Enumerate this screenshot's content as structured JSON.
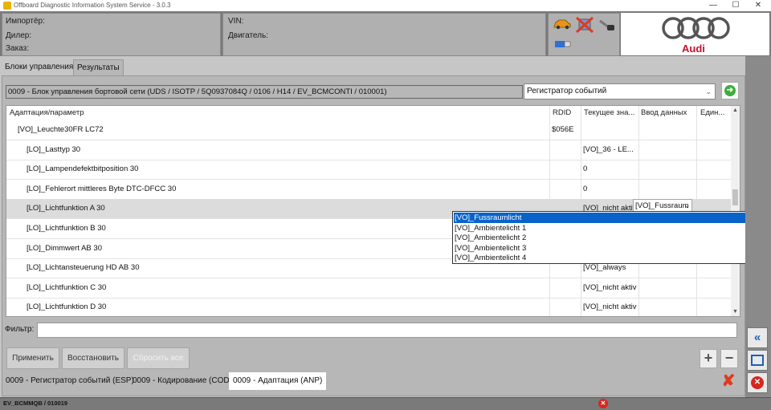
{
  "window": {
    "title": "Offboard Diagnostic Information System Service - 3.0.3",
    "minimize": "—",
    "maximize": "☐",
    "close": "✕"
  },
  "header": {
    "importer_label": "Импортёр:",
    "dealer_label": "Дилер:",
    "order_label": "Заказ:",
    "vin_label": "VIN:",
    "engine_label": "Двигатель:",
    "brand": "Audi"
  },
  "tabs": [
    {
      "label": "Блоки управления",
      "active": false
    },
    {
      "label": "Результаты",
      "active": true
    }
  ],
  "ecu": {
    "description": "0009 - Блок управления бортовой сети  (UDS / ISOTP / 5Q0937084Q  / 0106 / H14 / EV_BCMCONTI / 010001)",
    "mode_selected": "Регистратор событий"
  },
  "grid": {
    "columns": [
      "Адаптация/параметр",
      "RDID",
      "Текущее зна...",
      "Ввод данных",
      "Един..."
    ],
    "rows": [
      {
        "param": "[VO]_Leuchte30FR LC72",
        "rdid": "$056E",
        "current": "",
        "input": "",
        "unit": "",
        "indent": 1,
        "selected": false
      },
      {
        "param": "[LO]_Lasttyp 30",
        "rdid": "",
        "current": "[VO]_36 - LE...",
        "input": "",
        "unit": "",
        "indent": 2,
        "selected": false
      },
      {
        "param": "[LO]_Lampendefektbitposition 30",
        "rdid": "",
        "current": "0",
        "input": "",
        "unit": "",
        "indent": 2,
        "selected": false
      },
      {
        "param": "[LO]_Fehlerort mittleres Byte DTC-DFCC 30",
        "rdid": "",
        "current": "0",
        "input": "",
        "unit": "",
        "indent": 2,
        "selected": false
      },
      {
        "param": "[LO]_Lichtfunktion A 30",
        "rdid": "",
        "current": "[VO]_nicht aktiv",
        "input": "[VO]_Fussraum",
        "unit": "",
        "indent": 2,
        "selected": true
      },
      {
        "param": "[LO]_Lichtfunktion B 30",
        "rdid": "",
        "current": "",
        "input": "",
        "unit": "",
        "indent": 2,
        "selected": false
      },
      {
        "param": "[LO]_Dimmwert AB 30",
        "rdid": "",
        "current": "",
        "input": "",
        "unit": "",
        "indent": 2,
        "selected": false
      },
      {
        "param": "[LO]_Lichtansteuerung HD AB 30",
        "rdid": "",
        "current": "[VO]_always",
        "input": "",
        "unit": "",
        "indent": 2,
        "selected": false
      },
      {
        "param": "[LO]_Lichtfunktion C 30",
        "rdid": "",
        "current": "[VO]_nicht aktiv",
        "input": "",
        "unit": "",
        "indent": 2,
        "selected": false
      },
      {
        "param": "[LO]_Lichtfunktion D 30",
        "rdid": "",
        "current": "[VO]_nicht aktiv",
        "input": "",
        "unit": "",
        "indent": 2,
        "selected": false
      }
    ]
  },
  "dropdown": {
    "items": [
      {
        "label": "[VO]_Fussraumlicht",
        "highlighted": true
      },
      {
        "label": "[VO]_Ambientelicht 1",
        "highlighted": false
      },
      {
        "label": "[VO]_Ambientelicht 2",
        "highlighted": false
      },
      {
        "label": "[VO]_Ambientelicht 3",
        "highlighted": false
      },
      {
        "label": "[VO]_Ambientelicht 4",
        "highlighted": false
      }
    ]
  },
  "filter": {
    "label": "Фильтр:",
    "value": ""
  },
  "buttons": {
    "apply": "Применить",
    "restore": "Восстановить",
    "reset_all": "Сбросить все",
    "plus": "+",
    "minus": "−"
  },
  "bottom_tabs": [
    {
      "label": "0009 - Регистратор событий (ESP)",
      "active": false
    },
    {
      "label": "0009 - Кодирование (COD)",
      "active": false
    },
    {
      "label": "0009 - Адаптация (ANP)",
      "active": true
    }
  ],
  "status": {
    "text": "EV_BCMMQB / 010019"
  },
  "icons": {
    "car": "car-icon",
    "no_connection": "no-connection-icon",
    "key": "key-icon",
    "usb": "usb-icon",
    "go": "arrow-right-icon",
    "collapse": "double-chevron-left-icon",
    "window": "window-icon",
    "close": "close-icon"
  },
  "colors": {
    "selection_blue": "#0a63c9",
    "error_red": "#e03a1e",
    "go_green": "#3cae3c",
    "audi_red": "#c8102e"
  }
}
